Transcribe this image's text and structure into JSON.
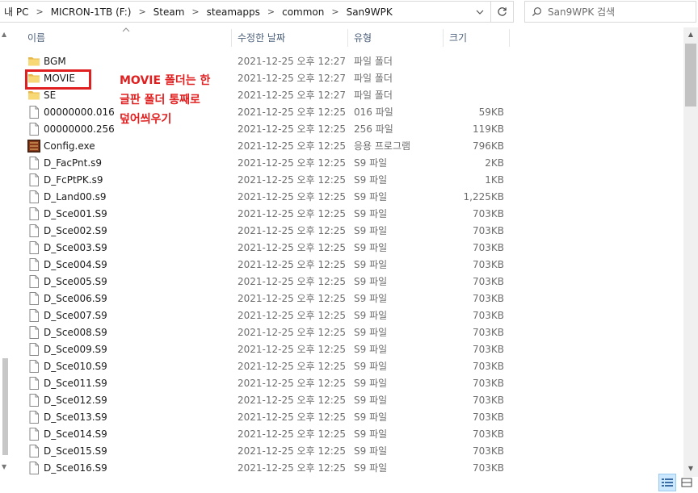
{
  "address": {
    "crumbs": [
      "내 PC",
      "MICRON-1TB (F:)",
      "Steam",
      "steamapps",
      "common",
      "San9WPK"
    ]
  },
  "search": {
    "placeholder": "San9WPK 검색"
  },
  "columns": {
    "name": "이름",
    "date": "수정한 날짜",
    "type": "유형",
    "size": "크기"
  },
  "files": [
    {
      "name": "BGM",
      "date": "2021-12-25 오후 12:27",
      "type": "파일 폴더",
      "size": "",
      "icon": "folder-icon"
    },
    {
      "name": "MOVIE",
      "date": "2021-12-25 오후 12:27",
      "type": "파일 폴더",
      "size": "",
      "icon": "folder-icon"
    },
    {
      "name": "SE",
      "date": "2021-12-25 오후 12:27",
      "type": "파일 폴더",
      "size": "",
      "icon": "folder-icon"
    },
    {
      "name": "00000000.016",
      "date": "2021-12-25 오후 12:25",
      "type": "016 파일",
      "size": "59KB",
      "icon": "file-icon"
    },
    {
      "name": "00000000.256",
      "date": "2021-12-25 오후 12:25",
      "type": "256 파일",
      "size": "119KB",
      "icon": "file-icon"
    },
    {
      "name": "Config.exe",
      "date": "2021-12-25 오후 12:25",
      "type": "응용 프로그램",
      "size": "796KB",
      "icon": "app-icon"
    },
    {
      "name": "D_FacPnt.s9",
      "date": "2021-12-25 오후 12:25",
      "type": "S9 파일",
      "size": "2KB",
      "icon": "file-icon"
    },
    {
      "name": "D_FcPtPK.s9",
      "date": "2021-12-25 오후 12:25",
      "type": "S9 파일",
      "size": "1KB",
      "icon": "file-icon"
    },
    {
      "name": "D_Land00.s9",
      "date": "2021-12-25 오후 12:25",
      "type": "S9 파일",
      "size": "1,225KB",
      "icon": "file-icon"
    },
    {
      "name": "D_Sce001.S9",
      "date": "2021-12-25 오후 12:25",
      "type": "S9 파일",
      "size": "703KB",
      "icon": "file-icon"
    },
    {
      "name": "D_Sce002.S9",
      "date": "2021-12-25 오후 12:25",
      "type": "S9 파일",
      "size": "703KB",
      "icon": "file-icon"
    },
    {
      "name": "D_Sce003.S9",
      "date": "2021-12-25 오후 12:25",
      "type": "S9 파일",
      "size": "703KB",
      "icon": "file-icon"
    },
    {
      "name": "D_Sce004.S9",
      "date": "2021-12-25 오후 12:25",
      "type": "S9 파일",
      "size": "703KB",
      "icon": "file-icon"
    },
    {
      "name": "D_Sce005.S9",
      "date": "2021-12-25 오후 12:25",
      "type": "S9 파일",
      "size": "703KB",
      "icon": "file-icon"
    },
    {
      "name": "D_Sce006.S9",
      "date": "2021-12-25 오후 12:25",
      "type": "S9 파일",
      "size": "703KB",
      "icon": "file-icon"
    },
    {
      "name": "D_Sce007.S9",
      "date": "2021-12-25 오후 12:25",
      "type": "S9 파일",
      "size": "703KB",
      "icon": "file-icon"
    },
    {
      "name": "D_Sce008.S9",
      "date": "2021-12-25 오후 12:25",
      "type": "S9 파일",
      "size": "703KB",
      "icon": "file-icon"
    },
    {
      "name": "D_Sce009.S9",
      "date": "2021-12-25 오후 12:25",
      "type": "S9 파일",
      "size": "703KB",
      "icon": "file-icon"
    },
    {
      "name": "D_Sce010.S9",
      "date": "2021-12-25 오후 12:25",
      "type": "S9 파일",
      "size": "703KB",
      "icon": "file-icon"
    },
    {
      "name": "D_Sce011.S9",
      "date": "2021-12-25 오후 12:25",
      "type": "S9 파일",
      "size": "703KB",
      "icon": "file-icon"
    },
    {
      "name": "D_Sce012.S9",
      "date": "2021-12-25 오후 12:25",
      "type": "S9 파일",
      "size": "703KB",
      "icon": "file-icon"
    },
    {
      "name": "D_Sce013.S9",
      "date": "2021-12-25 오후 12:25",
      "type": "S9 파일",
      "size": "703KB",
      "icon": "file-icon"
    },
    {
      "name": "D_Sce014.S9",
      "date": "2021-12-25 오후 12:25",
      "type": "S9 파일",
      "size": "703KB",
      "icon": "file-icon"
    },
    {
      "name": "D_Sce015.S9",
      "date": "2021-12-25 오후 12:25",
      "type": "S9 파일",
      "size": "703KB",
      "icon": "file-icon"
    },
    {
      "name": "D_Sce016.S9",
      "date": "2021-12-25 오후 12:25",
      "type": "S9 파일",
      "size": "703KB",
      "icon": "file-icon"
    }
  ],
  "annotation": {
    "lines": [
      "MOVIE 폴더는 한",
      "글판 폴더 통째로",
      "덮어씌우기"
    ],
    "color": "#e02020"
  },
  "colors": {
    "folder": "#f8d775",
    "header_text": "#4c607a",
    "accent": "#cce8ff"
  }
}
